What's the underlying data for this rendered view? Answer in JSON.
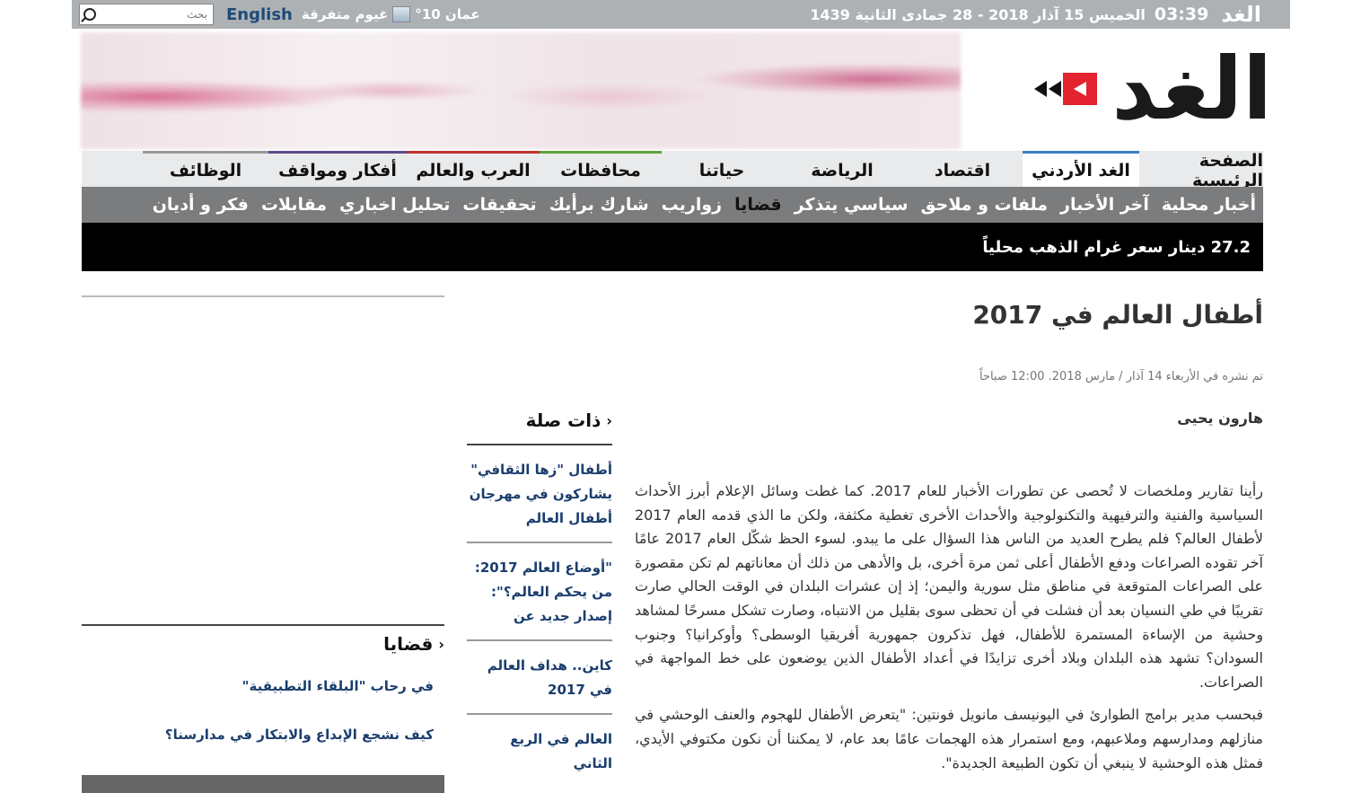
{
  "topbar": {
    "logo": "الغد",
    "time": "03:39",
    "date": "الخميس 15 آذار 2018 - 28 جمادى الثانية 1439",
    "weather": "عمان 10°",
    "weather_desc": "غيوم متفرقة",
    "english": "English",
    "search_placeholder": "بحث"
  },
  "brand": {
    "logo": "الغد"
  },
  "main_nav": [
    {
      "label": "الصفحة الرئيسية",
      "color": "#e9eaeb"
    },
    {
      "label": "الغد الأردني",
      "color": "#3b7fc4"
    },
    {
      "label": "اقتصاد",
      "color": "#e9eaeb"
    },
    {
      "label": "الرياضة",
      "color": "#e9eaeb"
    },
    {
      "label": "حياتنا",
      "color": "#e9eaeb"
    },
    {
      "label": "محافظات",
      "color": "#5fa33b"
    },
    {
      "label": "العرب والعالم",
      "color": "#c23131"
    },
    {
      "label": "أفكار ومواقف",
      "color": "#5d4a8a"
    },
    {
      "label": "الوظائف",
      "color": "#999999"
    }
  ],
  "sub_nav": [
    "أخبار محلية",
    "آخر الأخبار",
    "ملفات و ملاحق",
    "سياسي يتذكر",
    "قضايا",
    "زواريب",
    "شارك برأيك",
    "تحقيقات",
    "تحليل اخباري",
    "مقابلات",
    "فكر و أديان"
  ],
  "sub_nav_current": "قضايا",
  "ticker": "27.2 دينار سعر غرام الذهب محلياً",
  "article": {
    "title": "أطفال العالم في 2017",
    "meta": "تم نشره في الأربعاء 14 آذار / مارس 2018. 12:00 صباحاً",
    "author": "هارون يحيى",
    "paragraphs": [
      "رأينا تقارير وملخصات لا تُحصى عن تطورات الأخبار للعام 2017. كما غطت وسائل الإعلام أبرز الأحداث السياسية والفنية والترفيهية والتكنولوجية والأحداث الأخرى تغطية مكثفة، ولكن ما الذي قدمه العام 2017 لأطفال العالم؟ فلم يطرح العديد من الناس هذا السؤال على ما يبدو. لسوء الحظ شكّل العام 2017 عامًا آخر تقوده الصراعات ودفع الأطفال أعلى ثمن مرة أخرى، بل والأدهى من ذلك أن معاناتهم لم تكن مقصورة على الصراعات المتوقعة في مناطق مثل سورية واليمن؛ إذ إن عشرات البلدان في الوقت الحالي صارت تقريبًا في طي النسيان بعد أن فشلت في أن تحظى سوى بقليل من الانتباه، وصارت تشكل مسرحًا لمشاهد وحشية من الإساءة المستمرة للأطفال، فهل تذكرون جمهورية أفريقيا الوسطى؟ وأوكرانيا؟ وجنوب السودان؟ تشهد هذه البلدان وبلاد أخرى تزايدًا في أعداد الأطفال الذين يوضعون على خط المواجهة في الصراعات.",
      "فبحسب مدير برامج الطوارئ في اليونيسف مانويل فونتين: \"يتعرض الأطفال للهجوم والعنف الوحشي في منازلهم ومدارسهم وملاعبهم، ومع استمرار هذه الهجمات عامًا بعد عام، لا يمكننا أن نكون مكتوفي الأيدي، فمثل هذه الوحشية لا ينبغي أن تكون الطبيعة الجديدة\"."
    ]
  },
  "related": {
    "heading": "ذات صلة",
    "items": [
      "أطفال \"زها الثقافي\" يشاركون في مهرجان أطفال العالم",
      "\"أوضاع العالم 2017: من يحكم العالم؟\": إصدار جديد عن",
      "كاين.. هداف العالم في 2017",
      "العالم في الربع الثاني"
    ]
  },
  "sidebar": {
    "heading": "قضايا",
    "links": [
      "في رحاب \"البلقاء التطبيقية\"",
      "كيف نشجع الإبداع والابتكار في مدارسنا؟"
    ]
  }
}
